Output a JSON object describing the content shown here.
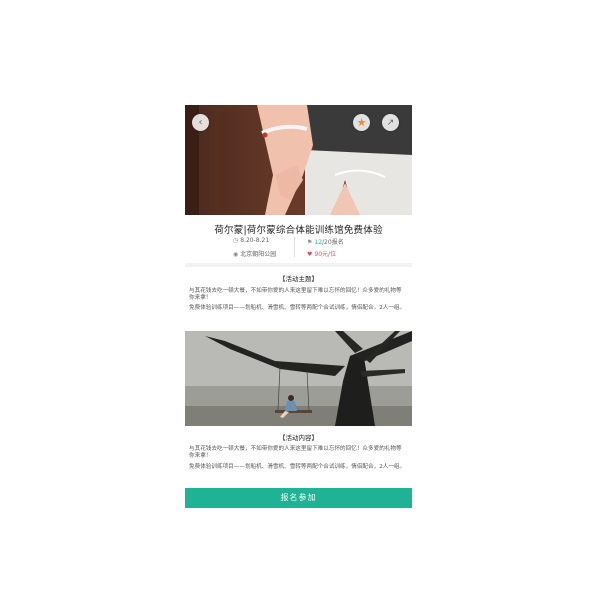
{
  "event": {
    "title": "荷尔蒙|荷尔蒙综合体能训练馆免费体验",
    "date": "8.20-8.21",
    "location": "北京朝阳公园",
    "signup_current": "12",
    "signup_rest": "/20报名",
    "price": "90元/位"
  },
  "sections": [
    {
      "heading": "【活动主题】",
      "para1": "与其花钱去吃一顿大餐，不如带你爱的人来这里留下难以忘怀的回忆！众多爱的礼物等你来拿！",
      "para2": "免费体验训练项目——划船机、滑雪机、雪转等两配个合试训练，情侣配合，2人一组。"
    },
    {
      "heading": "【活动内容】",
      "para1": "与其花钱去吃一顿大餐，不如带你爱的人来这里留下难以忘怀的回忆！众多爱的礼物等你来拿！",
      "para2": "免费体验训练项目——划船机、滑雪机、雪转等两配个合试训练，情侣配合，2人一组。"
    }
  ],
  "cta": {
    "label": "报名参加"
  },
  "icons": {
    "back": "back-arrow-icon",
    "favorite": "star-icon",
    "share": "share-icon",
    "calendar": "calendar-icon",
    "location": "location-pin-icon",
    "people": "people-icon",
    "price": "heart-icon"
  },
  "colors": {
    "accent": "#1db394",
    "price": "#e0505a",
    "star": "#f08a24"
  }
}
